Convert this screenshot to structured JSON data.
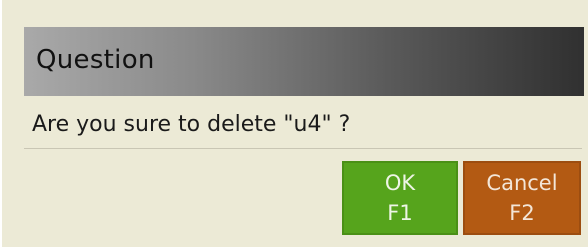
{
  "dialog": {
    "title": "Question",
    "message": "Are you sure to delete \"u4\" ?"
  },
  "buttons": {
    "ok": {
      "label": "OK",
      "key": "F1"
    },
    "cancel": {
      "label": "Cancel",
      "key": "F2"
    }
  },
  "colors": {
    "background": "#ecead6",
    "ok_button": "#56a41c",
    "cancel_button": "#b35a13",
    "title_gradient_start": "#a9a9a9",
    "title_gradient_end": "#303030"
  }
}
